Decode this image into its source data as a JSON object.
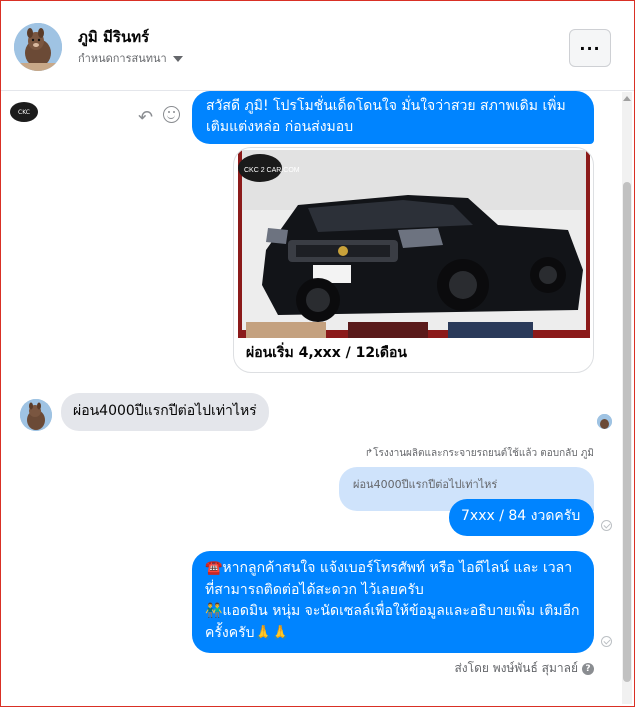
{
  "header": {
    "contact_name": "ภูมิ มีรินทร์",
    "conversation_settings": "กำหนดการสนทนา",
    "more_label": "···"
  },
  "messages": {
    "page_logo_text": "CKC",
    "promo_text": "สวัสดี ภูมิ! โปรโมชั่นเด็ดโดนใจ มั่นใจว่าสวย สภาพเดิม เพิ่มเติมแต่งหล่อ ก่อนส่งมอบ",
    "card_caption": "ผ่อนเริ่ม 4,xxx / 12เดือน",
    "card_image_watermark": "CKC 2 CAR.COM",
    "customer_question": "ผ่อน4000ปีแรกปีต่อไปเท่าไหร่",
    "reply_note": "↱โรงงานผลิตและกระจายรถยนต์ใช้แล้ว ตอบกลับ ภูมิ",
    "quoted_text": "ผ่อน4000ปีแรกปีต่อไปเท่าไหร่",
    "reply_answer": "7xxx / 84 งวดครับ",
    "final_line1": "☎️หากลูกค้าสนใจ แจ้งเบอร์โทรศัพท์ หรือ ไอดีไลน์ และ เวลาที่สามารถติดต่อได้สะดวก ไว้เลยครับ",
    "final_line2": "👬แอดมิน หนุ่ม จะนัดเซลล์เพื่อให้ข้อมูลและอธิบายเพิ่ม เติมอีกครั้งครับ🙏🙏",
    "sent_by": "ส่งโดย พงษ์พันธ์ สุมาลย์"
  },
  "colors": {
    "outgoing_bubble": "#0084ff",
    "incoming_bubble": "#e4e6eb",
    "quoted_bubble": "#cfe3fb"
  },
  "icons": [
    "more-icon",
    "caret-down-icon",
    "reply-icon",
    "emoji-icon",
    "seen-check-icon",
    "info-icon"
  ]
}
